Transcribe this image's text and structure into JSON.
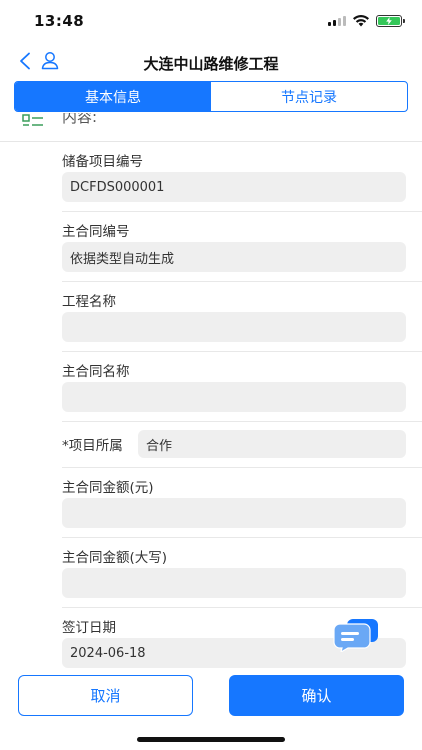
{
  "status_bar": {
    "time": "13:48"
  },
  "nav": {
    "title": "大连中山路维修工程"
  },
  "tabs": [
    {
      "label": "基本信息",
      "active": true
    },
    {
      "label": "节点记录",
      "active": false
    }
  ],
  "section": {
    "label": "内容:"
  },
  "fields": [
    {
      "label": "储备项目编号",
      "value": "DCFDS000001"
    },
    {
      "label": "主合同编号",
      "value": "依据类型自动生成"
    },
    {
      "label": "工程名称",
      "value": ""
    },
    {
      "label": "主合同名称",
      "value": ""
    },
    {
      "label": "*项目所属",
      "value": "合作"
    },
    {
      "label": "主合同金额(元)",
      "value": ""
    },
    {
      "label": "主合同金额(大写)",
      "value": ""
    },
    {
      "label": "签订日期",
      "value": "2024-06-18"
    }
  ],
  "buttons": {
    "cancel": "取消",
    "confirm": "确认"
  },
  "colors": {
    "accent": "#1677ff",
    "input_bg": "#efefef",
    "battery": "#34c759"
  }
}
